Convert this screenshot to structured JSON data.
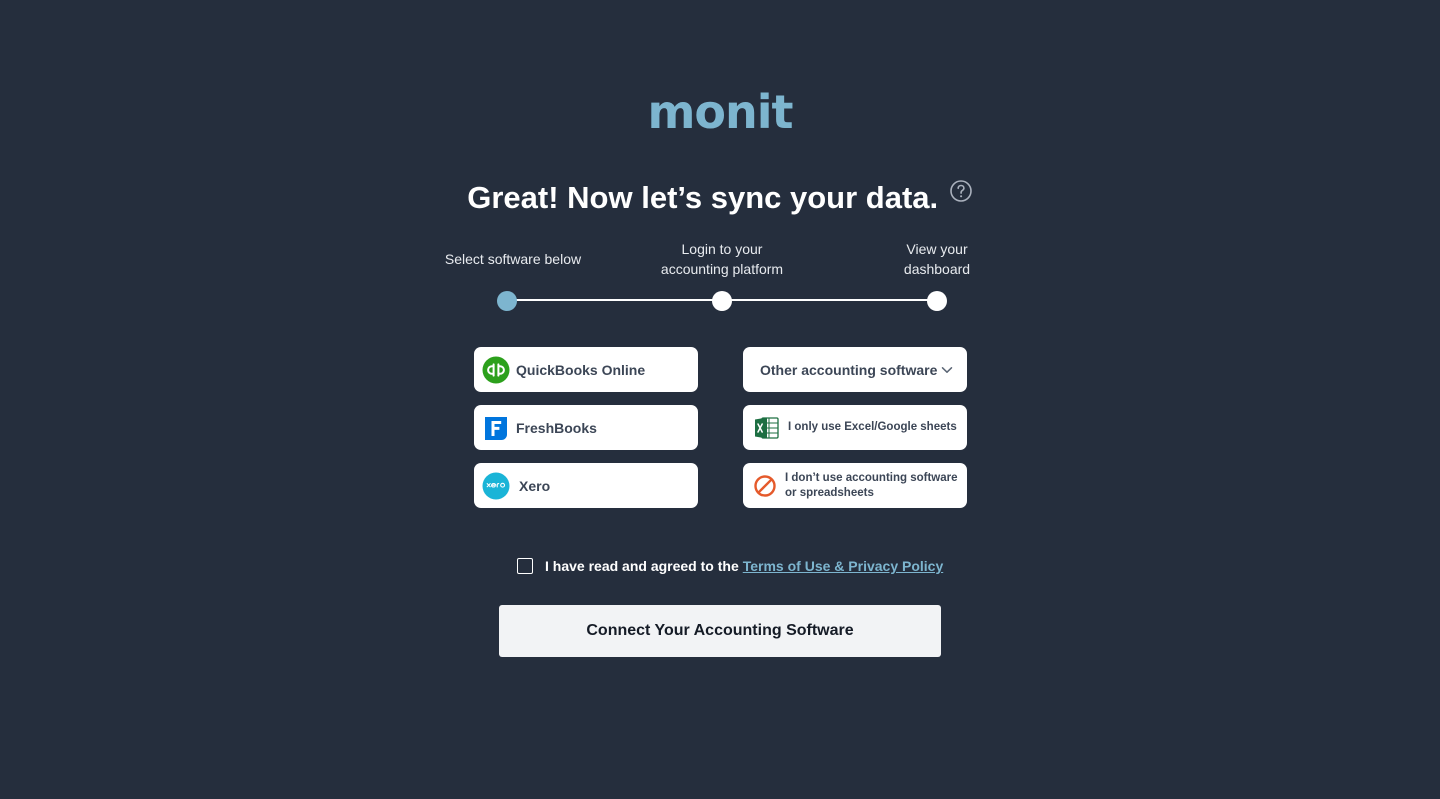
{
  "brand": {
    "logo_text": "monit",
    "accent_color": "#7db5cf",
    "background_color": "#252e3d"
  },
  "heading": {
    "title": "Great! Now let’s sync your data.",
    "help_icon": "question-circle-icon"
  },
  "steps": [
    {
      "line1": "Select software below",
      "line2": "",
      "state": "active"
    },
    {
      "line1": "Login to your",
      "line2": "accounting platform",
      "state": "pending"
    },
    {
      "line1": "View your",
      "line2": "dashboard",
      "state": "pending"
    }
  ],
  "options": {
    "quickbooks": {
      "label": "QuickBooks Online",
      "icon": "quickbooks-logo-icon"
    },
    "freshbooks": {
      "label": "FreshBooks",
      "icon": "freshbooks-logo-icon"
    },
    "xero": {
      "label": "Xero",
      "icon": "xero-logo-icon"
    },
    "other": {
      "label": "Other accounting software",
      "icon": "chevron-down-icon"
    },
    "spreadsheets": {
      "label": "I only use Excel/Google sheets",
      "icon": "excel-icon"
    },
    "none": {
      "line1": "I don’t use accounting software",
      "line2": "or spreadsheets",
      "icon": "prohibited-icon"
    }
  },
  "terms": {
    "text": "I have read and agreed to the",
    "link": "Terms of Use & Privacy Policy"
  },
  "connect_button": {
    "label": "Connect Your Accounting Software"
  }
}
